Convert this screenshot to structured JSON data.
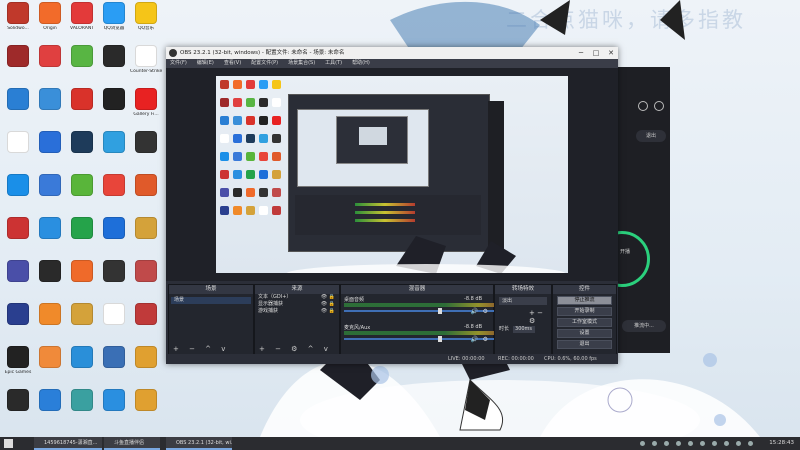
{
  "watermark": "二合点猫咪，请多指教",
  "desktop": {
    "icons": [
      {
        "label": "Solidwo...",
        "color": "#c0392b"
      },
      {
        "label": "Origin",
        "color": "#f26b2a"
      },
      {
        "label": "VALORANT",
        "color": "#e33a3a"
      },
      {
        "label": "QQ浏览器",
        "color": "#2a9df4"
      },
      {
        "label": "QQ音乐",
        "color": "#f5c518"
      },
      {
        "label": "",
        "color": "#9e2a2a"
      },
      {
        "label": "",
        "color": "#e04040"
      },
      {
        "label": "",
        "color": "#58b543"
      },
      {
        "label": "",
        "color": "#2a2a2a"
      },
      {
        "label": "Counter-Strike",
        "color": "#ffffff"
      },
      {
        "label": "",
        "color": "#2a7fd4"
      },
      {
        "label": "",
        "color": "#3a8fd9"
      },
      {
        "label": "",
        "color": "#d9322a"
      },
      {
        "label": "",
        "color": "#222222"
      },
      {
        "label": "Gallery Fi...",
        "color": "#e82222"
      },
      {
        "label": "",
        "color": "#ffffff"
      },
      {
        "label": "",
        "color": "#2a6fd9"
      },
      {
        "label": "",
        "color": "#1e3b5a"
      },
      {
        "label": "",
        "color": "#30a0e0"
      },
      {
        "label": "",
        "color": "#333333"
      },
      {
        "label": "",
        "color": "#1a8fe8"
      },
      {
        "label": "",
        "color": "#3a7ad9"
      },
      {
        "label": "",
        "color": "#59b53a"
      },
      {
        "label": "",
        "color": "#e8453a"
      },
      {
        "label": "",
        "color": "#e05a2a"
      },
      {
        "label": "",
        "color": "#cc3333"
      },
      {
        "label": "",
        "color": "#2a8fe0"
      },
      {
        "label": "",
        "color": "#25a34a"
      },
      {
        "label": "",
        "color": "#1e6fd9"
      },
      {
        "label": "",
        "color": "#d4a23a"
      },
      {
        "label": "",
        "color": "#4a4fa8"
      },
      {
        "label": "",
        "color": "#2a2a2a"
      },
      {
        "label": "",
        "color": "#ef6a2a"
      },
      {
        "label": "",
        "color": "#333333"
      },
      {
        "label": "",
        "color": "#c04a4a"
      },
      {
        "label": "",
        "color": "#2a3f8f"
      },
      {
        "label": "",
        "color": "#f08a2a"
      },
      {
        "label": "",
        "color": "#d4a23a"
      },
      {
        "label": "",
        "color": "#ffffff"
      },
      {
        "label": "",
        "color": "#c03a3a"
      },
      {
        "label": "Epic Games",
        "color": "#222222"
      },
      {
        "label": "",
        "color": "#f08a3a"
      },
      {
        "label": "",
        "color": "#2a8fd9"
      },
      {
        "label": "",
        "color": "#3a6fb5"
      },
      {
        "label": "",
        "color": "#e0a030"
      },
      {
        "label": "",
        "color": "#2a2a2a"
      },
      {
        "label": "",
        "color": "#2a7fd9"
      },
      {
        "label": "",
        "color": "#3aa0a0"
      },
      {
        "label": "",
        "color": "#2a8fe0"
      },
      {
        "label": "",
        "color": "#e0a030"
      }
    ]
  },
  "obs": {
    "title": "OBS 23.2.1 (32-bit, windows) - 配置文件: 未命名 - 场景: 未命名",
    "menu": [
      "文件(F)",
      "编辑(E)",
      "查看(V)",
      "配置文件(P)",
      "场景集合(S)",
      "工具(T)",
      "帮助(H)"
    ],
    "docks": {
      "scenes": {
        "title": "场景",
        "items": [
          "场景"
        ]
      },
      "sources": {
        "title": "来源",
        "items": [
          "文本（GDI+）",
          "显示器捕获",
          "游戏捕获"
        ]
      },
      "mixer": {
        "title": "混音器",
        "rows": [
          {
            "name": "桌面音频",
            "db": "-8.8 dB"
          },
          {
            "name": "麦克风/Aux",
            "db": "-8.8 dB"
          }
        ]
      },
      "transitions": {
        "title": "转场特效",
        "selected": "淡出",
        "duration_label": "时长",
        "duration_value": "300ms"
      },
      "controls": {
        "title": "控件",
        "buttons": [
          {
            "label": "停止推流",
            "active": true
          },
          {
            "label": "开始录制",
            "active": false
          },
          {
            "label": "工作室模式",
            "active": false
          },
          {
            "label": "设置",
            "active": false
          },
          {
            "label": "退出",
            "active": false
          }
        ]
      }
    },
    "status": {
      "live": "LIVE: 00:00:00",
      "rec": "REC: 00:00:00",
      "cpu": "CPU: 0.6%, 60.00 fps"
    },
    "window_buttons": {
      "min": "─",
      "max": "□",
      "close": "✕"
    }
  },
  "side_app": {
    "btn_exit": "退出",
    "btn_bottom": "推流中...",
    "ring_text": "开播"
  },
  "taskbar": {
    "items": [
      {
        "label": "1459618745-潇湘直..."
      },
      {
        "label": "斗鱼直播伴侣"
      },
      {
        "label": "OBS 23.2.1 (32-bit, wi..."
      }
    ],
    "clock": "15:28:43"
  }
}
